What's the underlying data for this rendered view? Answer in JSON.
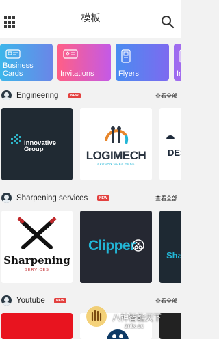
{
  "header": {
    "title": "模板"
  },
  "categories": [
    {
      "label": "Business Cards",
      "icon": "id-card-icon"
    },
    {
      "label": "Invitations",
      "icon": "invitation-card-icon"
    },
    {
      "label": "Flyers",
      "icon": "flyer-icon"
    },
    {
      "label": "In",
      "icon": "card-icon"
    }
  ],
  "sections": [
    {
      "name": "Engineering",
      "badge": "NEW",
      "see_all": "查看全部",
      "cards": [
        {
          "logo_text": "Innovative Group"
        },
        {
          "logo_text": "LOGIMECH",
          "sub_text": "SLOGAN GOES HERE"
        },
        {
          "logo_text": "DES"
        }
      ]
    },
    {
      "name": "Sharpening services",
      "badge": "NEW",
      "see_all": "查看全部",
      "cards": [
        {
          "logo_text": "Sharpening",
          "sub_text": "SERVICES"
        },
        {
          "logo_text": "Clipper"
        },
        {
          "logo_text": "Sha"
        }
      ]
    },
    {
      "name": "Youtube",
      "badge": "NEW",
      "see_all": "查看全部"
    }
  ],
  "watermark": {
    "text": "八神智能天下",
    "url": "zntx.cc"
  },
  "colors": {
    "badge": "#e3413f",
    "dark_card": "#202a33",
    "accent_orange": "#e8862b",
    "accent_teal": "#22b6d6"
  }
}
